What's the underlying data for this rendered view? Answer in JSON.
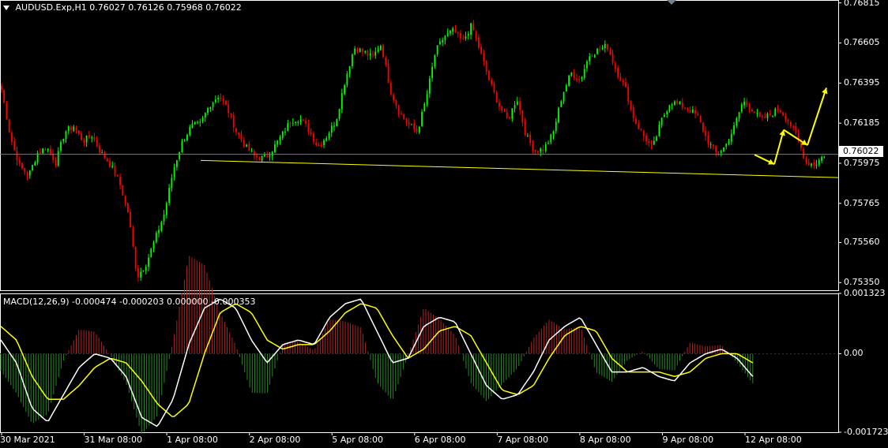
{
  "symbol": "AUDUSD.Exp,H1",
  "ohlc": [
    "0.76027",
    "0.76126",
    "0.75968",
    "0.76022"
  ],
  "current_price": "0.76022",
  "macd_label": "MACD(12,26,9)",
  "macd_values": [
    "-0.000474",
    "-0.000203",
    "0.000000",
    "-0.000353"
  ],
  "colors": {
    "background": "#000000",
    "bull_candle": "#00ff00",
    "bear_candle": "#ff0000",
    "macd_main": "#ffffff",
    "macd_signal": "#ffff00",
    "hist_pos": "#b22222",
    "hist_neg": "#228b22",
    "trendline": "#ffff00",
    "axis": "#ffffff",
    "grid_line": "#708090"
  },
  "chart_data": [
    {
      "type": "candlestick",
      "title": "AUDUSD.Exp,H1",
      "y_ticks": [
        "0.76815",
        "0.76605",
        "0.76395",
        "0.76185",
        "0.75975",
        "0.75765",
        "0.75560",
        "0.75350"
      ],
      "x_ticks": [
        "30 Mar 2021",
        "31 Mar 08:00",
        "1 Apr 08:00",
        "2 Apr 08:00",
        "5 Apr 08:00",
        "6 Apr 08:00",
        "7 Apr 08:00",
        "8 Apr 08:00",
        "9 Apr 08:00",
        "12 Apr 08:00"
      ],
      "ylim": [
        0.7531,
        0.7683
      ],
      "close_path": [
        0.7636,
        0.7611,
        0.7596,
        0.7591,
        0.7603,
        0.7606,
        0.7598,
        0.7614,
        0.7617,
        0.7609,
        0.7612,
        0.7603,
        0.7597,
        0.7588,
        0.7572,
        0.7538,
        0.7545,
        0.7558,
        0.7571,
        0.7594,
        0.7609,
        0.7617,
        0.7618,
        0.7628,
        0.7633,
        0.7626,
        0.7614,
        0.7606,
        0.7601,
        0.76,
        0.7605,
        0.7612,
        0.762,
        0.7621,
        0.7615,
        0.7606,
        0.7612,
        0.762,
        0.7641,
        0.7658,
        0.7656,
        0.7653,
        0.766,
        0.7636,
        0.7624,
        0.7618,
        0.7614,
        0.7632,
        0.7656,
        0.7664,
        0.7667,
        0.7661,
        0.767,
        0.7655,
        0.764,
        0.7628,
        0.762,
        0.7632,
        0.7612,
        0.7604,
        0.7605,
        0.7613,
        0.7633,
        0.7645,
        0.7641,
        0.7654,
        0.7657,
        0.7659,
        0.7646,
        0.7637,
        0.762,
        0.7612,
        0.7605,
        0.762,
        0.763,
        0.7628,
        0.7626,
        0.7622,
        0.761,
        0.7603,
        0.7606,
        0.7616,
        0.763,
        0.7626,
        0.762,
        0.7623,
        0.7626,
        0.762,
        0.7611,
        0.7598,
        0.7597,
        0.7602
      ],
      "annotations": [
        {
          "type": "current_price_line",
          "value": 0.76022
        },
        {
          "type": "trendline",
          "from": [
            "1 Apr 08:00",
            0.7599
          ],
          "to": [
            "12 Apr 08:00",
            0.7592
          ]
        },
        {
          "type": "forecast_arrows",
          "color": "yellow",
          "points": [
            0.7602,
            0.7597,
            0.7615,
            0.7607,
            0.7637
          ]
        }
      ]
    },
    {
      "type": "line",
      "title": "MACD(12,26,9)",
      "y_ticks": [
        "0.001323",
        "0.00",
        "-0.001723"
      ],
      "ylim": [
        -0.001723,
        0.001323
      ],
      "series": [
        {
          "name": "MACD",
          "values": [
            0.0003,
            -0.0002,
            -0.0012,
            -0.0015,
            -0.0009,
            -0.0003,
            0.0,
            -0.0001,
            -0.0005,
            -0.0014,
            -0.0016,
            -0.001,
            0.0002,
            0.001,
            0.0012,
            0.001,
            0.0003,
            -0.0002,
            0.0002,
            0.0003,
            0.0002,
            0.0008,
            0.0011,
            0.0012,
            0.0005,
            -0.0002,
            -0.0001,
            0.0006,
            0.0008,
            0.0007,
            0.0,
            -0.0007,
            -0.001,
            -0.0009,
            -0.0004,
            0.0003,
            0.0006,
            0.0008,
            0.0002,
            -0.0004,
            -0.0004,
            -0.0003,
            -0.0005,
            -0.0006,
            -0.0002,
            0.0,
            0.0001,
            -0.0001,
            -0.0005
          ]
        },
        {
          "name": "Signal",
          "values": [
            0.0006,
            0.0003,
            -0.0005,
            -0.001,
            -0.001,
            -0.0007,
            -0.0003,
            -0.0001,
            -0.0002,
            -0.0006,
            -0.0011,
            -0.0014,
            -0.0011,
            0.0,
            0.0009,
            0.0011,
            0.0009,
            0.0003,
            0.0001,
            0.0002,
            0.0002,
            0.0005,
            0.0009,
            0.0011,
            0.001,
            0.0004,
            -0.0001,
            0.0001,
            0.0005,
            0.0006,
            0.0004,
            -0.0002,
            -0.0008,
            -0.0009,
            -0.0007,
            -0.0001,
            0.0004,
            0.0006,
            0.0005,
            -0.0001,
            -0.0004,
            -0.0004,
            -0.0004,
            -0.0005,
            -0.0004,
            -0.0001,
            0.0,
            0.0,
            -0.0002
          ]
        }
      ]
    }
  ]
}
